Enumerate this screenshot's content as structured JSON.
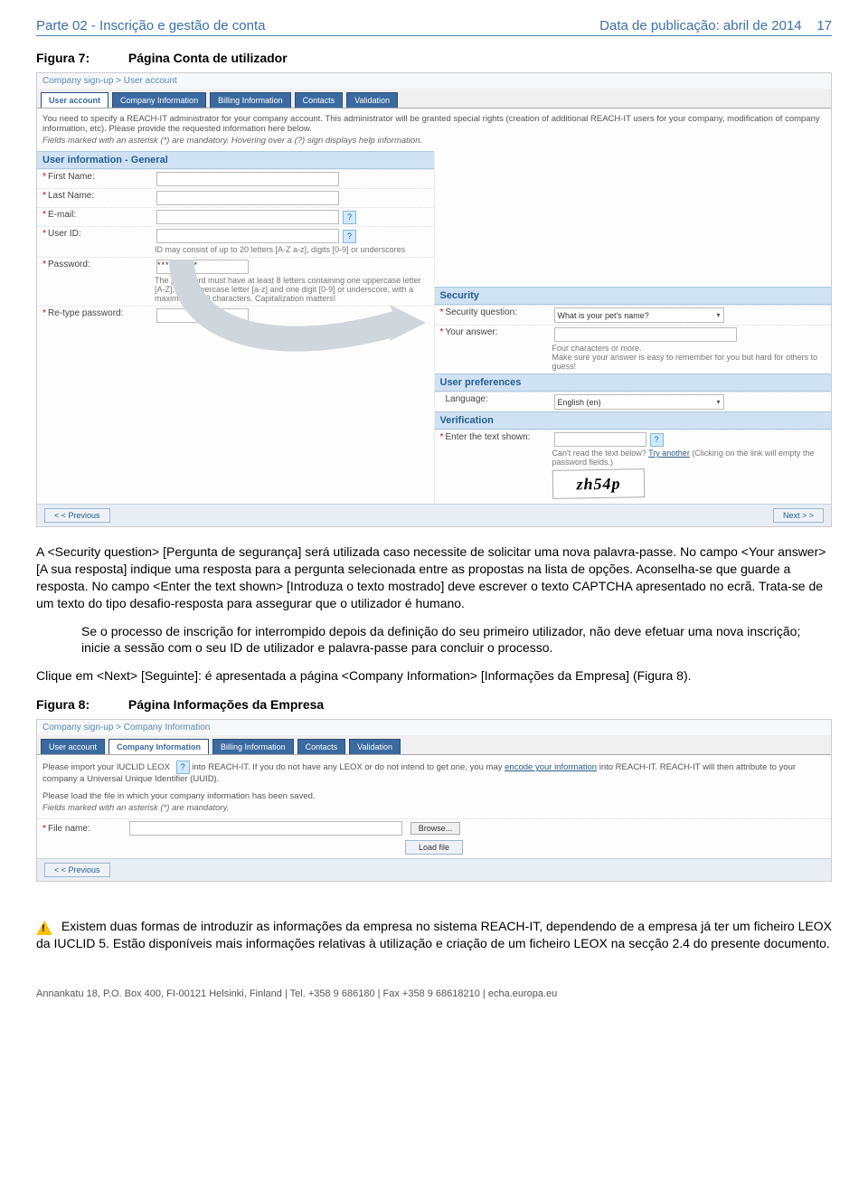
{
  "header": {
    "left": "Parte 02 - Inscrição e gestão de conta",
    "right_label": "Data de publicação: abril de 2014",
    "page_number": "17"
  },
  "figure7": {
    "number": "Figura 7:",
    "title": "Página Conta de utilizador"
  },
  "sshot1": {
    "breadcrumb": "Company sign-up > User account",
    "tabs": [
      "User account",
      "Company Information",
      "Billing Information",
      "Contacts",
      "Validation"
    ],
    "intro": "You need to specify a REACH-IT administrator for your company account. This administrator will be granted special rights (creation of additional REACH-IT users for your company, modification of company information, etc). Please provide the requested information here below.",
    "sub": "Fields marked with an asterisk (*) are mandatory. Hovering over a (?) sign displays help information.",
    "section_general": "User information - General",
    "labels": {
      "first_name": "First Name:",
      "last_name": "Last Name:",
      "email": "E-mail:",
      "user_id": "User ID:",
      "password": "Password:",
      "retype": "Re-type password:"
    },
    "hints": {
      "user_id": "ID may consist of up to 20 letters [A-Z a-z], digits [0-9] or underscores",
      "password": "The password must have at least 8 letters containing one uppercase letter [A-Z], one lowercase letter [a-z] and one digit [0-9] or underscore, with a maximum of 20 characters. Capitalization matters!"
    },
    "password_value": "**********",
    "section_security": "Security",
    "security": {
      "question_label": "Security question:",
      "question_value": "What is your pet's name?",
      "answer_label": "Your answer:",
      "answer_hint": "Four characters or more.\nMake sure your answer is easy to remember for you but hard for others to guess!"
    },
    "section_prefs": "User preferences",
    "prefs": {
      "language_label": "Language:",
      "language_value": "English (en)"
    },
    "section_verify": "Verification",
    "verify": {
      "enter_label": "Enter the text shown:",
      "cant_read": "Can't read the text below? ",
      "try_another": "Try another",
      "try_suffix": " (Clicking on the link will empty the password fields.)",
      "captcha": "zh54p"
    },
    "buttons": {
      "prev": "< < Previous",
      "next": "Next > >"
    }
  },
  "paragraphs": {
    "p1": "A <Security question> [Pergunta de segurança] será utilizada caso necessite de solicitar uma nova palavra-passe. No campo <Your answer> [A sua resposta] indique uma resposta para a pergunta selecionada entre as propostas na lista de opções. Aconselha-se que guarde a resposta. No campo <Enter the text shown> [Introduza o texto mostrado] deve escrever o texto CAPTCHA apresentado no ecrã. Trata-se de um texto do tipo desafio-resposta para assegurar que o utilizador é humano.",
    "p2": "Se o processo de inscrição for interrompido depois da definição do seu primeiro utilizador, não deve efetuar uma nova inscrição; inicie a sessão com o seu ID de utilizador e palavra-passe para concluir o processo.",
    "p3": "Clique em <Next> [Seguinte]: é apresentada a página <Company Information> [Informações da Empresa] (Figura 8)."
  },
  "figure8": {
    "number": "Figura 8:",
    "title": "Página Informações da Empresa"
  },
  "sshot2": {
    "breadcrumb": "Company sign-up > Company Information",
    "tabs": [
      "User account",
      "Company Information",
      "Billing Information",
      "Contacts",
      "Validation"
    ],
    "line1_a": "Please import your IUCLID LEOX ",
    "line1_b": " into REACH-IT. If you do not have any LEOX or do not intend to get one, you may ",
    "line1_link": "encode your information",
    "line1_c": " into REACH-IT. REACH-IT will then attribute to your company a Universal Unique Identifier (UUID).",
    "line2": "Please load the file in which your company information has been saved.",
    "line3": "Fields marked with an asterisk (*) are mandatory.",
    "file_label": "File name:",
    "browse": "Browse...",
    "loadfile": "Load file",
    "prev": "< < Previous"
  },
  "warning_text": "Existem duas formas de introduzir as informações da empresa no sistema REACH-IT, dependendo de a empresa já ter um ficheiro LEOX da IUCLID 5. Estão disponíveis mais informações relativas à utilização e criação de um ficheiro LEOX na secção 2.4 do presente documento.",
  "footer": "Annankatu 18, P.O. Box 400, FI-00121 Helsinki, Finland | Tel. +358 9 686180 | Fax +358 9 68618210 | echa.europa.eu"
}
